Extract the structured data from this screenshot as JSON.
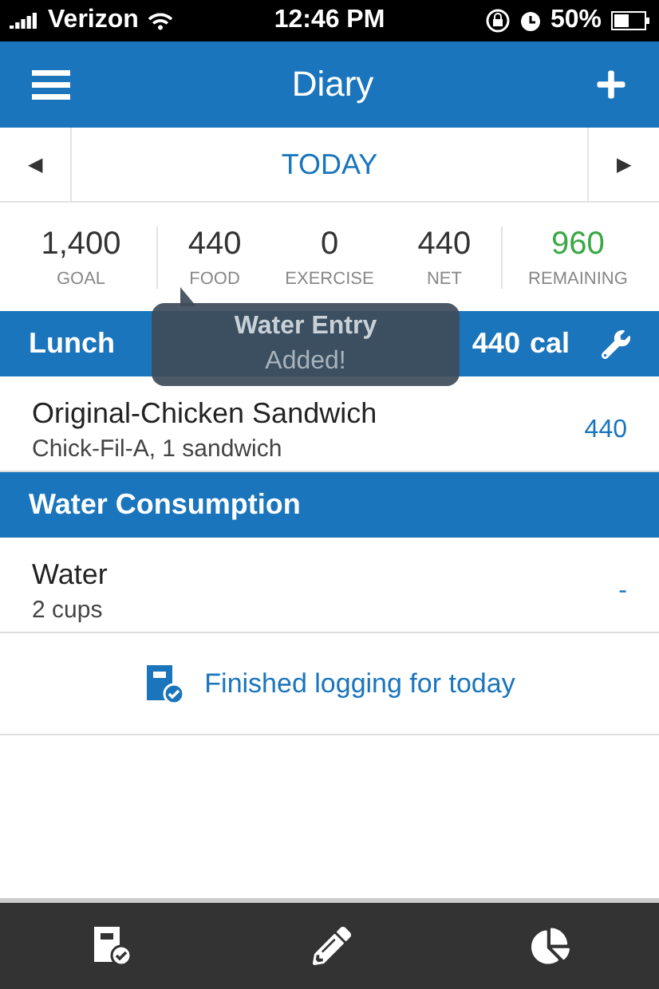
{
  "status_bar": {
    "carrier": "Verizon",
    "time": "12:46 PM",
    "battery": "50%"
  },
  "header": {
    "title": "Diary"
  },
  "date_nav": {
    "prev": "◀",
    "label": "TODAY",
    "next": "▶"
  },
  "summary": [
    {
      "value": "1,400",
      "label": "GOAL",
      "kind": "plain"
    },
    {
      "value": "440",
      "label": "FOOD",
      "kind": "plain"
    },
    {
      "value": "0",
      "label": "EXERCISE",
      "kind": "plain"
    },
    {
      "value": "440",
      "label": "NET",
      "kind": "plain"
    },
    {
      "value": "960",
      "label": "REMAINING",
      "kind": "highlight"
    }
  ],
  "sections": [
    {
      "title": "Lunch",
      "calories": "440",
      "unit": "cal",
      "settings": true,
      "entries": [
        {
          "name": "Original-Chicken Sandwich",
          "detail": "Chick-Fil-A, 1 sandwich",
          "value": "440"
        }
      ]
    },
    {
      "title": "Water Consumption",
      "settings": false,
      "entries": [
        {
          "name": "Water",
          "detail": "2 cups",
          "value": "-"
        }
      ]
    }
  ],
  "finish": {
    "label": "Finished logging for today"
  },
  "toast": {
    "title": "Water Entry",
    "message": "Added!"
  },
  "tab_bar": [
    {
      "kind": "diary"
    },
    {
      "kind": "edit"
    },
    {
      "kind": "chart"
    }
  ]
}
